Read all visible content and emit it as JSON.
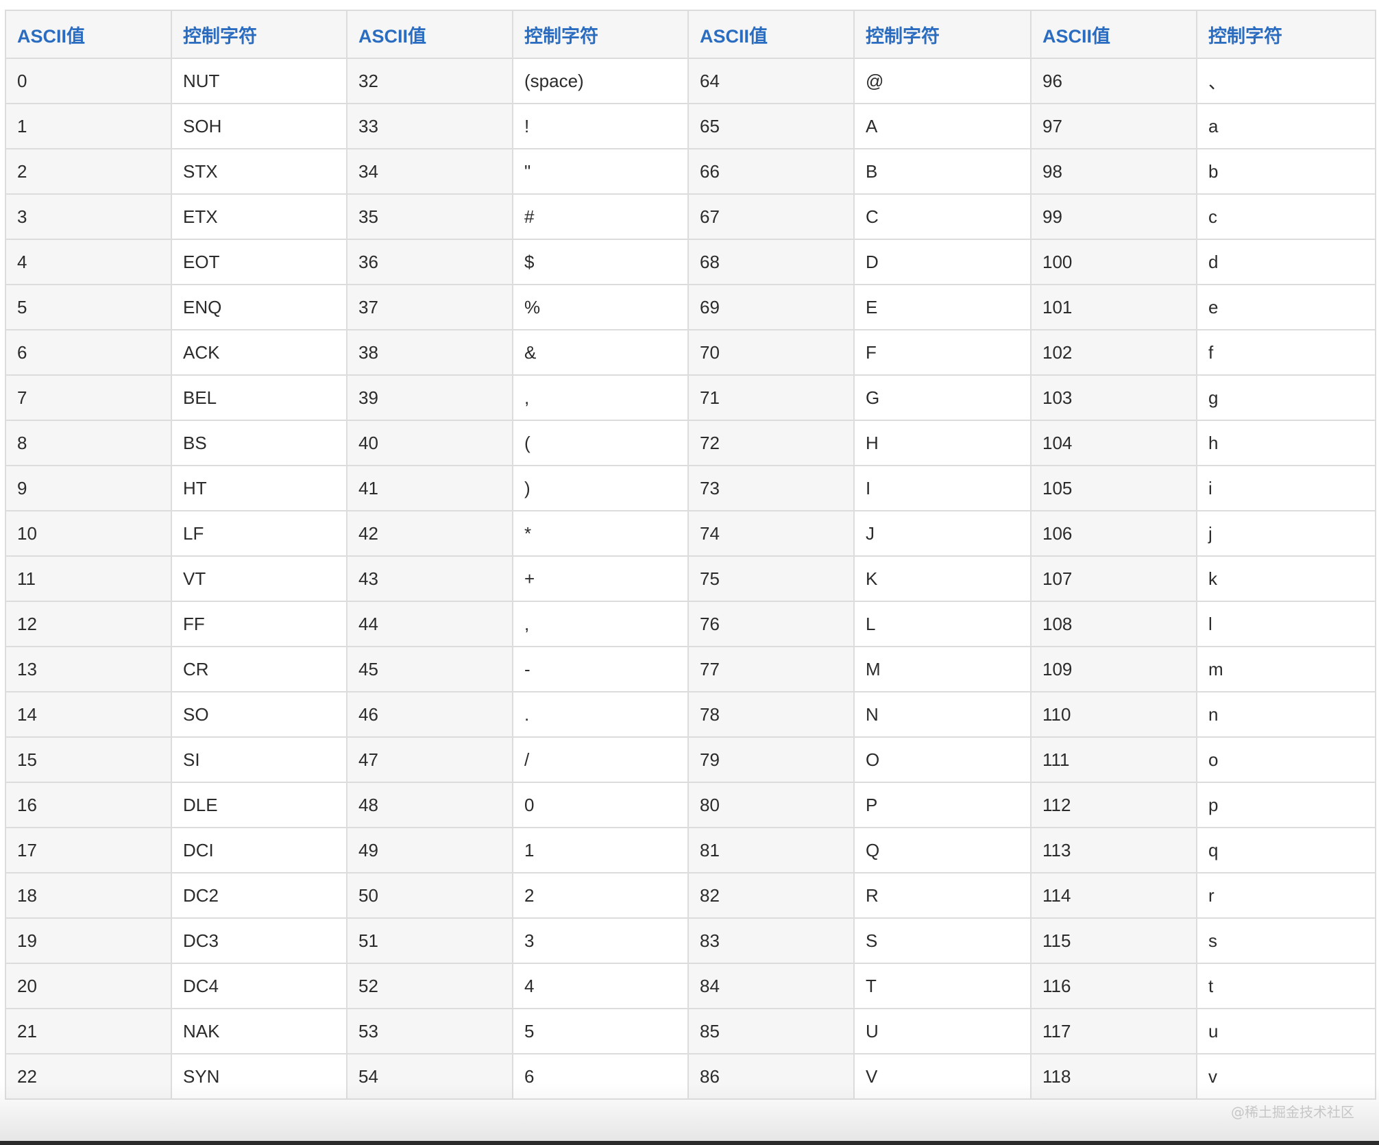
{
  "table": {
    "headers": [
      "ASCII值",
      "控制字符",
      "ASCII值",
      "控制字符",
      "ASCII值",
      "控制字符",
      "ASCII值",
      "控制字符"
    ],
    "rows": [
      [
        "0",
        "NUT",
        "32",
        "(space)",
        "64",
        "@",
        "96",
        "、"
      ],
      [
        "1",
        "SOH",
        "33",
        "!",
        "65",
        "A",
        "97",
        "a"
      ],
      [
        "2",
        "STX",
        "34",
        "\"",
        "66",
        "B",
        "98",
        "b"
      ],
      [
        "3",
        "ETX",
        "35",
        "#",
        "67",
        "C",
        "99",
        "c"
      ],
      [
        "4",
        "EOT",
        "36",
        "$",
        "68",
        "D",
        "100",
        "d"
      ],
      [
        "5",
        "ENQ",
        "37",
        "%",
        "69",
        "E",
        "101",
        "e"
      ],
      [
        "6",
        "ACK",
        "38",
        "&",
        "70",
        "F",
        "102",
        "f"
      ],
      [
        "7",
        "BEL",
        "39",
        ",",
        "71",
        "G",
        "103",
        "g"
      ],
      [
        "8",
        "BS",
        "40",
        "(",
        "72",
        "H",
        "104",
        "h"
      ],
      [
        "9",
        "HT",
        "41",
        ")",
        "73",
        "I",
        "105",
        "i"
      ],
      [
        "10",
        "LF",
        "42",
        "*",
        "74",
        "J",
        "106",
        "j"
      ],
      [
        "11",
        "VT",
        "43",
        "+",
        "75",
        "K",
        "107",
        "k"
      ],
      [
        "12",
        "FF",
        "44",
        ",",
        "76",
        "L",
        "108",
        "l"
      ],
      [
        "13",
        "CR",
        "45",
        "-",
        "77",
        "M",
        "109",
        "m"
      ],
      [
        "14",
        "SO",
        "46",
        ".",
        "78",
        "N",
        "110",
        "n"
      ],
      [
        "15",
        "SI",
        "47",
        "/",
        "79",
        "O",
        "111",
        "o"
      ],
      [
        "16",
        "DLE",
        "48",
        "0",
        "80",
        "P",
        "112",
        "p"
      ],
      [
        "17",
        "DCI",
        "49",
        "1",
        "81",
        "Q",
        "113",
        "q"
      ],
      [
        "18",
        "DC2",
        "50",
        "2",
        "82",
        "R",
        "114",
        "r"
      ],
      [
        "19",
        "DC3",
        "51",
        "3",
        "83",
        "S",
        "115",
        "s"
      ],
      [
        "20",
        "DC4",
        "52",
        "4",
        "84",
        "T",
        "116",
        "t"
      ],
      [
        "21",
        "NAK",
        "53",
        "5",
        "85",
        "U",
        "117",
        "u"
      ],
      [
        "22",
        "SYN",
        "54",
        "6",
        "86",
        "V",
        "118",
        "v"
      ]
    ]
  },
  "watermark": "@稀土掘金技术社区",
  "colors": {
    "header_text": "#2a6cc0",
    "cell_text": "#2b2b2b",
    "border": "#dcdcdc",
    "stripe": "#f6f6f6"
  }
}
